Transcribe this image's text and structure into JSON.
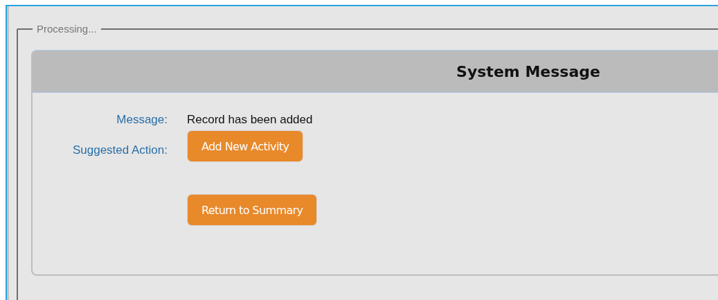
{
  "fieldset": {
    "legend": "Processing..."
  },
  "panel": {
    "title": "System Message",
    "rows": [
      {
        "kind": "text",
        "label": "Message:",
        "value": "Record has been added"
      },
      {
        "kind": "actions",
        "label": "Suggested Action:",
        "buttons": [
          "Add New Activity",
          "Return to Summary"
        ]
      }
    ]
  }
}
